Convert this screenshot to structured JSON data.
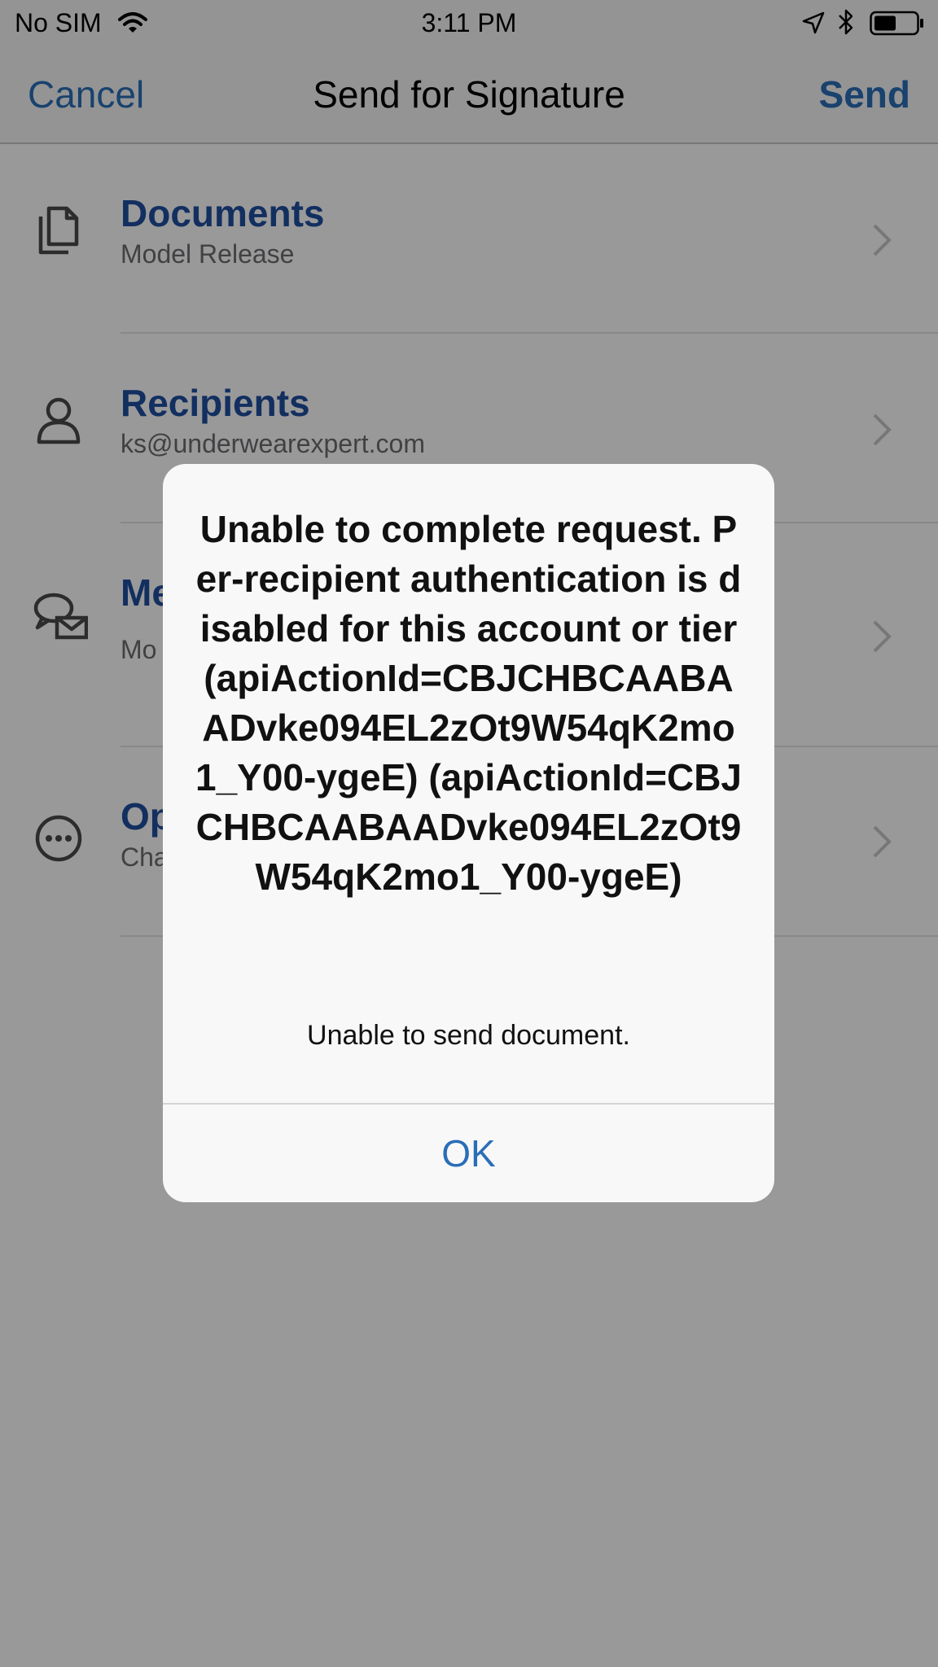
{
  "status_bar": {
    "carrier": "No SIM",
    "time": "3:11 PM",
    "icons": [
      "wifi-icon",
      "location-arrow-icon",
      "bluetooth-icon",
      "battery-icon"
    ]
  },
  "nav": {
    "cancel_label": "Cancel",
    "title": "Send for Signature",
    "send_label": "Send"
  },
  "list": {
    "items": [
      {
        "icon": "documents-icon",
        "title": "Documents",
        "subtitle": "Model Release"
      },
      {
        "icon": "person-icon",
        "title": "Recipients",
        "subtitle": "ks@underwearexpert.com"
      },
      {
        "icon": "message-icon",
        "title": "Me",
        "subtitle": "Mo"
      },
      {
        "icon": "ellipsis-icon",
        "title": "Op",
        "subtitle": "Cha"
      }
    ]
  },
  "alert": {
    "title": "Unable to complete request. Per-recipient authentication is disabled for this account or tier (apiActionId=CBJCHBCAABAADvke094EL2zOt9W54qK2mo1_Y00-ygeE) (apiActionId=CBJCHBCAABAADvke094EL2zOt9W54qK2mo1_Y00-ygeE)",
    "message": "Unable to send document.",
    "ok_label": "OK"
  },
  "colors": {
    "accent": "#2a6eb7",
    "row_title": "#1f4fa0",
    "overlay": "rgba(0,0,0,0.40)"
  }
}
